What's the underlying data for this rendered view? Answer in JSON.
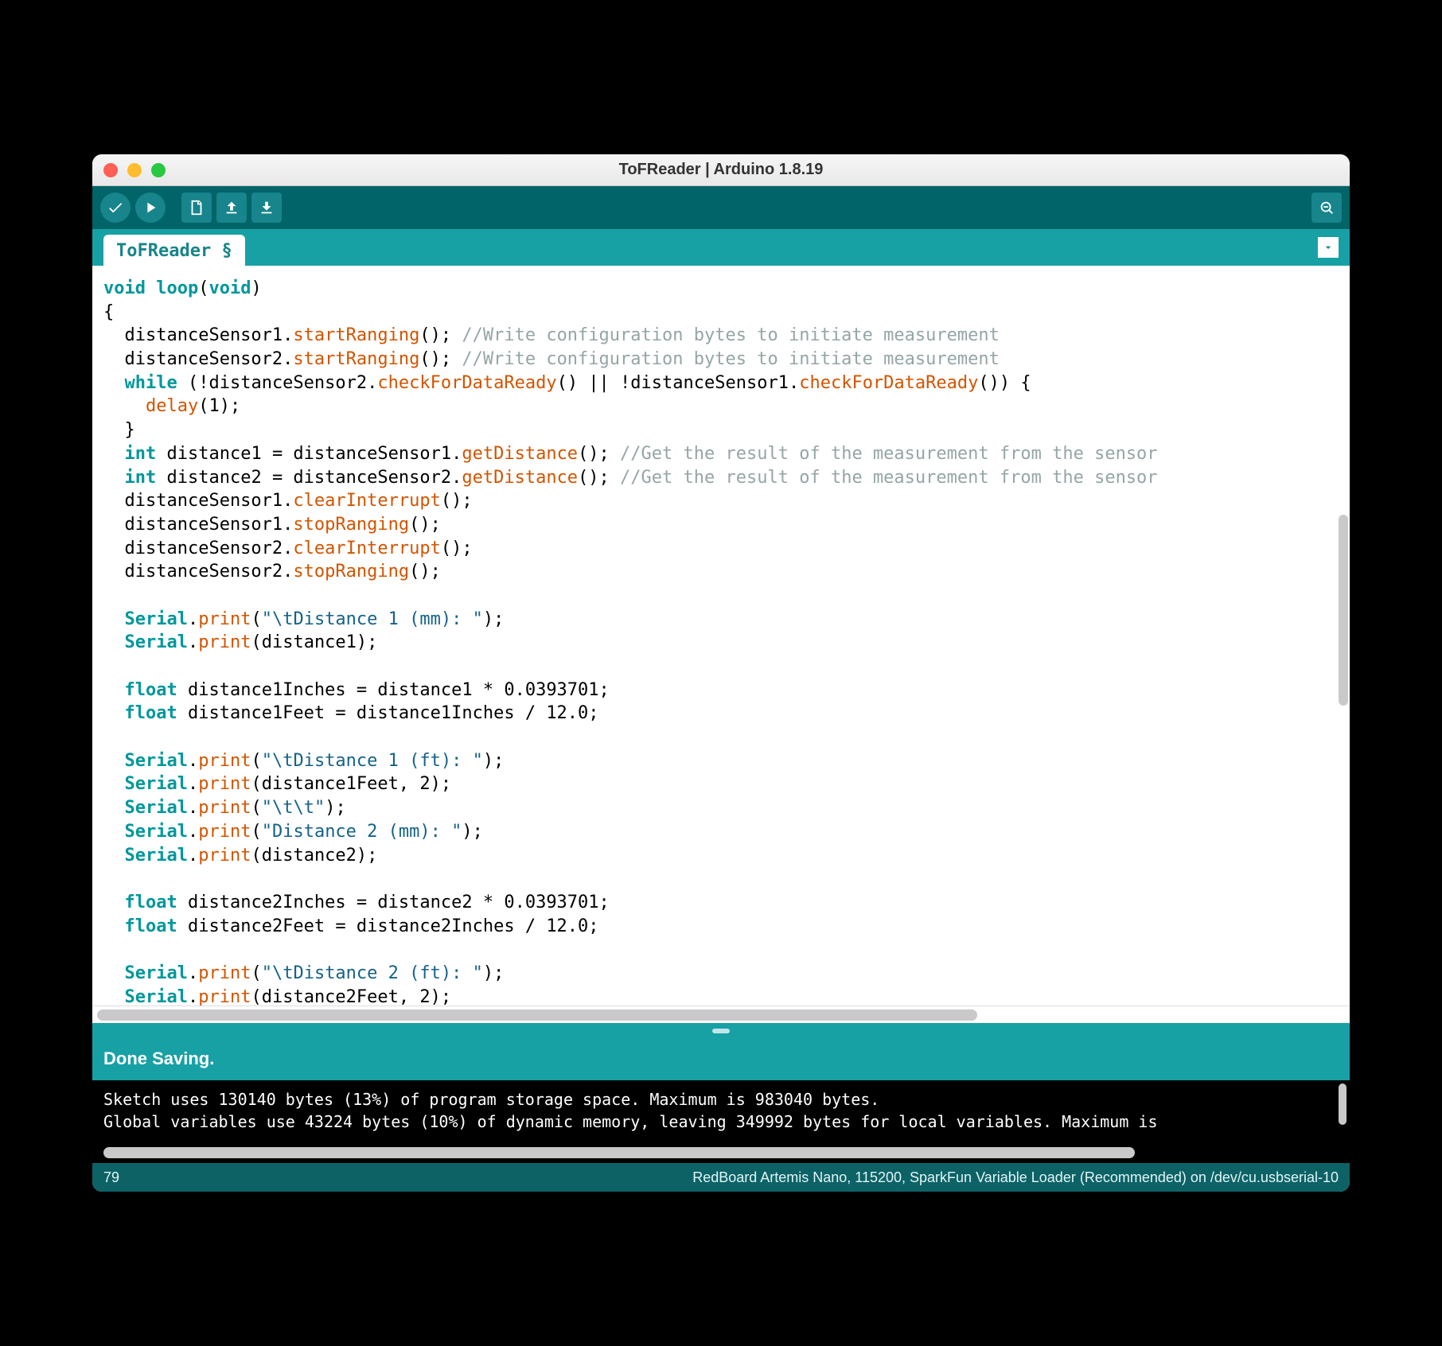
{
  "window": {
    "title": "ToFReader | Arduino 1.8.19"
  },
  "tab": {
    "label": "ToFReader §"
  },
  "status": {
    "message": "Done Saving."
  },
  "console": {
    "line1": "Sketch uses 130140 bytes (13%) of program storage space. Maximum is 983040 bytes.",
    "line2": "Global variables use 43224 bytes (10%) of dynamic memory, leaving 349992 bytes for local variables. Maximum is "
  },
  "footer": {
    "line_number": "79",
    "board_info": "RedBoard Artemis Nano, 115200, SparkFun Variable Loader (Recommended) on /dev/cu.usbserial-10"
  },
  "code": {
    "tokens": [
      [
        [
          "kw",
          "void"
        ],
        [
          "",
          " "
        ],
        [
          "kw",
          "loop"
        ],
        [
          "",
          "("
        ],
        [
          "kw",
          "void"
        ],
        [
          "",
          ")"
        ]
      ],
      [
        [
          "",
          "{"
        ]
      ],
      [
        [
          "",
          "  distanceSensor1."
        ],
        [
          "fn",
          "startRanging"
        ],
        [
          "",
          "(); "
        ],
        [
          "cm",
          "//Write configuration bytes to initiate measurement"
        ]
      ],
      [
        [
          "",
          "  distanceSensor2."
        ],
        [
          "fn",
          "startRanging"
        ],
        [
          "",
          "(); "
        ],
        [
          "cm",
          "//Write configuration bytes to initiate measurement"
        ]
      ],
      [
        [
          "",
          "  "
        ],
        [
          "kw",
          "while"
        ],
        [
          "",
          " (!distanceSensor2."
        ],
        [
          "fn",
          "checkForDataReady"
        ],
        [
          "",
          "() "
        ],
        [
          "",
          "|| !distanceSensor1."
        ],
        [
          "fn",
          "checkForDataReady"
        ],
        [
          "",
          "()) {"
        ]
      ],
      [
        [
          "",
          "    "
        ],
        [
          "fn",
          "delay"
        ],
        [
          "",
          "(1);"
        ]
      ],
      [
        [
          "",
          "  }"
        ]
      ],
      [
        [
          "",
          "  "
        ],
        [
          "kw",
          "int"
        ],
        [
          "",
          " distance1 = distanceSensor1."
        ],
        [
          "fn",
          "getDistance"
        ],
        [
          "",
          "(); "
        ],
        [
          "cm",
          "//Get the result of the measurement from the sensor"
        ]
      ],
      [
        [
          "",
          "  "
        ],
        [
          "kw",
          "int"
        ],
        [
          "",
          " distance2 = distanceSensor2."
        ],
        [
          "fn",
          "getDistance"
        ],
        [
          "",
          "(); "
        ],
        [
          "cm",
          "//Get the result of the measurement from the sensor"
        ]
      ],
      [
        [
          "",
          "  distanceSensor1."
        ],
        [
          "fn",
          "clearInterrupt"
        ],
        [
          "",
          "();"
        ]
      ],
      [
        [
          "",
          "  distanceSensor1."
        ],
        [
          "fn",
          "stopRanging"
        ],
        [
          "",
          "();"
        ]
      ],
      [
        [
          "",
          "  distanceSensor2."
        ],
        [
          "fn",
          "clearInterrupt"
        ],
        [
          "",
          "();"
        ]
      ],
      [
        [
          "",
          "  distanceSensor2."
        ],
        [
          "fn",
          "stopRanging"
        ],
        [
          "",
          "();"
        ]
      ],
      [
        [
          "",
          ""
        ]
      ],
      [
        [
          "",
          "  "
        ],
        [
          "kw",
          "Serial"
        ],
        [
          "",
          "."
        ],
        [
          "fn",
          "print"
        ],
        [
          "",
          "("
        ],
        [
          "str",
          "\"\\tDistance 1 (mm): \""
        ],
        [
          "",
          ");"
        ]
      ],
      [
        [
          "",
          "  "
        ],
        [
          "kw",
          "Serial"
        ],
        [
          "",
          "."
        ],
        [
          "fn",
          "print"
        ],
        [
          "",
          "(distance1);"
        ]
      ],
      [
        [
          "",
          ""
        ]
      ],
      [
        [
          "",
          "  "
        ],
        [
          "kw",
          "float"
        ],
        [
          "",
          " distance1Inches = distance1 * 0.0393701;"
        ]
      ],
      [
        [
          "",
          "  "
        ],
        [
          "kw",
          "float"
        ],
        [
          "",
          " distance1Feet = distance1Inches / 12.0;"
        ]
      ],
      [
        [
          "",
          ""
        ]
      ],
      [
        [
          "",
          "  "
        ],
        [
          "kw",
          "Serial"
        ],
        [
          "",
          "."
        ],
        [
          "fn",
          "print"
        ],
        [
          "",
          "("
        ],
        [
          "str",
          "\"\\tDistance 1 (ft): \""
        ],
        [
          "",
          ");"
        ]
      ],
      [
        [
          "",
          "  "
        ],
        [
          "kw",
          "Serial"
        ],
        [
          "",
          "."
        ],
        [
          "fn",
          "print"
        ],
        [
          "",
          "(distance1Feet, 2);"
        ]
      ],
      [
        [
          "",
          "  "
        ],
        [
          "kw",
          "Serial"
        ],
        [
          "",
          "."
        ],
        [
          "fn",
          "print"
        ],
        [
          "",
          "("
        ],
        [
          "str",
          "\"\\t\\t\""
        ],
        [
          "",
          ");"
        ]
      ],
      [
        [
          "",
          "  "
        ],
        [
          "kw",
          "Serial"
        ],
        [
          "",
          "."
        ],
        [
          "fn",
          "print"
        ],
        [
          "",
          "("
        ],
        [
          "str",
          "\"Distance 2 (mm): \""
        ],
        [
          "",
          ");"
        ]
      ],
      [
        [
          "",
          "  "
        ],
        [
          "kw",
          "Serial"
        ],
        [
          "",
          "."
        ],
        [
          "fn",
          "print"
        ],
        [
          "",
          "(distance2);"
        ]
      ],
      [
        [
          "",
          ""
        ]
      ],
      [
        [
          "",
          "  "
        ],
        [
          "kw",
          "float"
        ],
        [
          "",
          " distance2Inches = distance2 * 0.0393701;"
        ]
      ],
      [
        [
          "",
          "  "
        ],
        [
          "kw",
          "float"
        ],
        [
          "",
          " distance2Feet = distance2Inches / 12.0;"
        ]
      ],
      [
        [
          "",
          ""
        ]
      ],
      [
        [
          "",
          "  "
        ],
        [
          "kw",
          "Serial"
        ],
        [
          "",
          "."
        ],
        [
          "fn",
          "print"
        ],
        [
          "",
          "("
        ],
        [
          "str",
          "\"\\tDistance 2 (ft): \""
        ],
        [
          "",
          ");"
        ]
      ],
      [
        [
          "",
          "  "
        ],
        [
          "kw",
          "Serial"
        ],
        [
          "",
          "."
        ],
        [
          "fn",
          "print"
        ],
        [
          "",
          "(distance2Feet, 2);"
        ]
      ]
    ]
  }
}
